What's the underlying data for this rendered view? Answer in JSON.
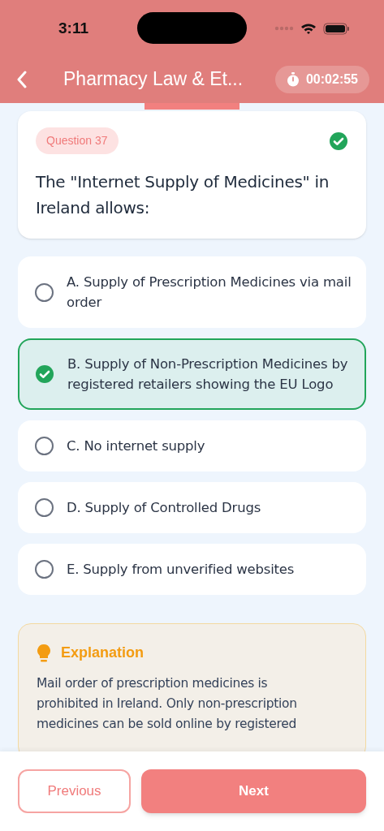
{
  "status_bar": {
    "time": "3:11"
  },
  "header": {
    "title": "Pharmacy Law & Et...",
    "timer": "00:02:55"
  },
  "question": {
    "badge": "Question 37",
    "answered": true,
    "text": "The \"Internet Supply of Medicines\" in Ireland allows:"
  },
  "options": [
    {
      "text": "A. Supply of Prescription Medicines via mail order",
      "selected": false
    },
    {
      "text": "B. Supply of Non-Prescription Medicines by registered retailers showing the EU Logo",
      "selected": true
    },
    {
      "text": "C. No internet supply",
      "selected": false
    },
    {
      "text": "D. Supply of Controlled Drugs",
      "selected": false
    },
    {
      "text": "E. Supply from unverified websites",
      "selected": false
    }
  ],
  "explanation": {
    "title": "Explanation",
    "lines": [
      "Mail order of prescription medicines is",
      "prohibited in Ireland. Only non-prescription",
      "medicines can be sold online by registered"
    ]
  },
  "footer": {
    "previous": "Previous",
    "next": "Next"
  }
}
